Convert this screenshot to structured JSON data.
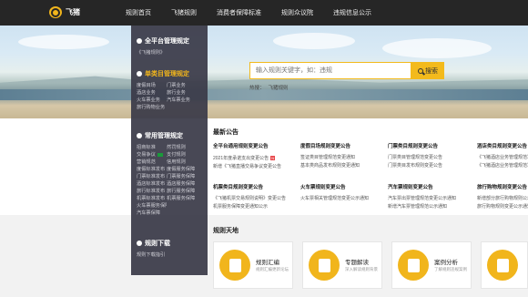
{
  "header": {
    "logo_text": "飞猪",
    "nav": [
      "规则首页",
      "飞猪规则",
      "消费者保障标准",
      "规则众议院",
      "违规信息公示"
    ]
  },
  "search": {
    "placeholder": "输入规则关键字，如：违规",
    "button_label": "搜索",
    "hot_label": "热搜：",
    "hot_items": [
      "飞猪规则"
    ]
  },
  "sidebar": {
    "sections": [
      {
        "title": "全平台管理规定",
        "rows": [
          [
            "《飞猪规则》",
            ""
          ]
        ]
      },
      {
        "title": "单类目管理规定",
        "active": true,
        "rows": [
          [
            "度假目场",
            "门票业务"
          ],
          [
            "酒店业务",
            "旅行业务"
          ],
          [
            "火车票业务",
            "汽车票业务"
          ],
          [
            "旅行购物业务",
            ""
          ]
        ]
      },
      {
        "title": "常用管理规定",
        "rows": [
          [
            "招商标准",
            "然罚规则"
          ],
          [
            "交易争议",
            "支付规则"
          ],
          [
            "营销规范",
            "信用规则"
          ],
          [
            "度假标准发布",
            "度假服务保障"
          ],
          [
            "门票标准发布",
            "门票服务保障"
          ],
          [
            "酒店标准发布",
            "酒店服务保障"
          ],
          [
            "旅行标准发布",
            "旅行服务保障"
          ],
          [
            "机票标准发布",
            "机票服务保障"
          ],
          [
            "火车票服务保障",
            ""
          ],
          [
            "汽车票保障",
            ""
          ]
        ]
      },
      {
        "title": "规则下载",
        "rows": [
          [
            "规则下载指引",
            ""
          ]
        ]
      }
    ]
  },
  "announcements": {
    "title": "最新公告",
    "columns": [
      {
        "head": "全平台通用规则变更公告",
        "items": [
          "2021年度承诺支出变更公告",
          "新增《飞猪直播交易争议变更公告"
        ]
      },
      {
        "head": "度假目场规则变更公告",
        "items": [
          "签证类目管理规范变更通知",
          "基本类商品发布规则变更通知"
        ]
      },
      {
        "head": "门票类目规则变更公告",
        "items": [
          "门票类目管理规范变更公告",
          "门票类目发布规则变更公告"
        ]
      },
      {
        "head": "酒店类目规则变更公告",
        "items": [
          "《飞猪酒店业务管理规范》",
          "《飞猪酒店业务管理规范》"
        ]
      },
      {
        "head": "机票类目规则变更公告",
        "items": [
          "《飞猪机票交易规则说明》变更公告",
          "机票服务保障变更通知公示"
        ]
      },
      {
        "head": "火车票规则变更公告",
        "items": [
          "火车票相关管理规范变更公示通知"
        ]
      },
      {
        "head": "汽车票规则变更公告",
        "items": [
          "汽车票出票管理规范变更公示通知",
          "新增汽车票管理规范公示通知"
        ]
      },
      {
        "head": "旅行购物规则变更公告",
        "items": [
          "新增部分旅行购物规则公示",
          "旅行购物规则变更公示通知"
        ]
      }
    ]
  },
  "rules": {
    "title": "规则天地",
    "cards": [
      {
        "name": "规则汇编",
        "desc": "规则汇编更新论坛"
      },
      {
        "name": "专题解读",
        "desc": "深入解读规则背景"
      },
      {
        "name": "案例分析",
        "desc": "了解规则违规案例"
      },
      {
        "name": "",
        "desc": ""
      }
    ]
  },
  "colors": {
    "accent": "#f3ba1c",
    "topbar": "#262626",
    "panel": "#3a3a48"
  }
}
